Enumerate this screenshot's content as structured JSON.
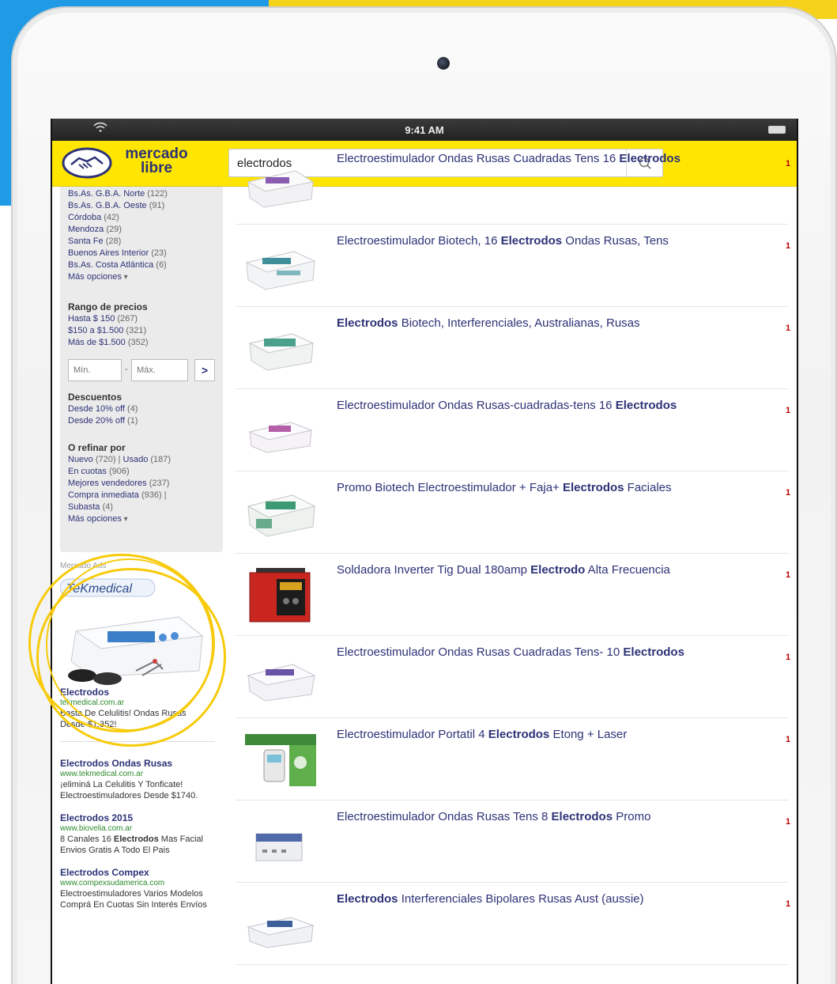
{
  "status_bar": {
    "time": "9:41 AM"
  },
  "brand": {
    "line1": "mercado",
    "line2": "libre"
  },
  "search": {
    "value": "electrodos"
  },
  "filters": {
    "location": [
      {
        "label": "Bs.As. G.B.A. Norte",
        "count": "(122)"
      },
      {
        "label": "Bs.As. G.B.A. Oeste",
        "count": "(91)"
      },
      {
        "label": "Córdoba",
        "count": "(42)"
      },
      {
        "label": "Mendoza",
        "count": "(29)"
      },
      {
        "label": "Santa Fe",
        "count": "(28)"
      },
      {
        "label": "Buenos Aires Interior",
        "count": "(23)"
      },
      {
        "label": "Bs.As. Costa Atlántica",
        "count": "(6)"
      }
    ],
    "location_more": "Más opciones",
    "price_title": "Rango de precios",
    "price": [
      {
        "label": "Hasta $ 150",
        "count": "(267)"
      },
      {
        "label": "$150 a $1.500",
        "count": "(321)"
      },
      {
        "label": "Más de $1.500",
        "count": "(352)"
      }
    ],
    "min_placeholder": "Mín.",
    "max_placeholder": "Máx.",
    "go": ">",
    "discount_title": "Descuentos",
    "discounts": [
      {
        "label": "Desde 10% off",
        "count": "(4)"
      },
      {
        "label": "Desde 20% off",
        "count": "(1)"
      }
    ],
    "refine_title": "O refinar por",
    "refine": {
      "new": "Nuevo",
      "new_count": "(720)",
      "sep": "|",
      "used": "Usado",
      "used_count": "(187)",
      "installments": "En cuotas",
      "installments_count": "(906)",
      "best_sellers": "Mejores vendedores",
      "best_sellers_count": "(237)",
      "buy_now": "Compra inmediata",
      "buy_now_count": "(936) |",
      "auction": "Subasta",
      "auction_count": "(4)"
    },
    "refine_more": "Más opciones"
  },
  "ads": {
    "label": "Mercado Ads",
    "image_brand": "TeKmedical",
    "items": [
      {
        "title": "Electrodos",
        "url": "tekmedical.com.ar",
        "desc": "Basta De Celulitis! Ondas Rusas Desde $1.352!"
      },
      {
        "title": "Electrodos Ondas Rusas",
        "url": "www.tekmedical.com.ar",
        "desc": "¡eliminá La Celulitis Y Tonficate! Electroestimuladores Desde $1740."
      },
      {
        "title": "Electrodos 2015",
        "url": "www.biovelia.com.ar",
        "desc_pre": "8 Canales 16 ",
        "desc_bold": "Electrodos",
        "desc_post": " Mas Facial Envios Gratis A Todo El Pais"
      },
      {
        "title": "Electrodos Compex",
        "url": "www.compexsudamerica.com",
        "desc": "Electroestimuladores Varios Modelos Comprá En Cuotas Sin Interés Envíos"
      }
    ]
  },
  "results": [
    {
      "pre": "Electroestimulador Ondas Rusas Cuadradas Tens 16 ",
      "bold": "Electrodos",
      "post": ""
    },
    {
      "pre": "Electroestimulador Biotech, 16 ",
      "bold": "Electrodos",
      "post": " Ondas Rusas, Tens"
    },
    {
      "pre": "",
      "bold": "Electrodos",
      "post": " Biotech, Interferenciales, Australianas, Rusas"
    },
    {
      "pre": "Electroestimulador Ondas Rusas-cuadradas-tens 16 ",
      "bold": "Electrodos",
      "post": ""
    },
    {
      "pre": "Promo Biotech Electroestimulador + Faja+ ",
      "bold": "Electrodos",
      "post": " Faciales"
    },
    {
      "pre": "Soldadora Inverter Tig Dual 180amp ",
      "bold": "Electrodo",
      "post": " Alta Frecuencia"
    },
    {
      "pre": "Electroestimulador Ondas Rusas Cuadradas Tens- 10 ",
      "bold": "Electrodos",
      "post": ""
    },
    {
      "pre": "Electroestimulador Portatil 4 ",
      "bold": "Electrodos",
      "post": " Etong + Laser"
    },
    {
      "pre": "Electroestimulador Ondas Rusas Tens 8 ",
      "bold": "Electrodos",
      "post": " Promo"
    },
    {
      "pre": "",
      "bold": "Electrodos",
      "post": " Interferenciales Bipolares Rusas Aust (aussie)"
    }
  ],
  "price_fragment": "1",
  "colors": {
    "brand_yellow": "#ffe600",
    "link_blue": "#2d3277",
    "ad_green": "#2c8a2c",
    "highlight_ring": "#f7cb0c",
    "frame_blue": "#1f9be6"
  },
  "icons": [
    "wifi-icon",
    "battery-icon",
    "handshake-logo-icon",
    "search-icon",
    "chevron-down-icon",
    "chevron-right-icon"
  ]
}
